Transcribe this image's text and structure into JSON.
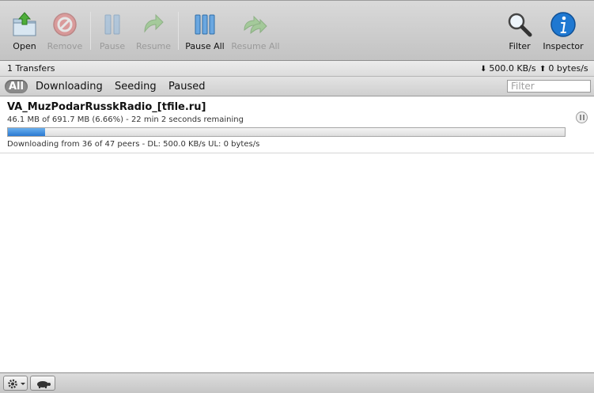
{
  "toolbar": {
    "open": "Open",
    "remove": "Remove",
    "pause": "Pause",
    "resume": "Resume",
    "pause_all": "Pause All",
    "resume_all": "Resume All",
    "filter": "Filter",
    "inspector": "Inspector"
  },
  "status": {
    "transfers": "1 Transfers",
    "download_rate": "500.0 KB/s",
    "upload_rate": "0 bytes/s"
  },
  "filter_tabs": [
    "All",
    "Downloading",
    "Seeding",
    "Paused"
  ],
  "filter_placeholder": "Filter",
  "transfers": [
    {
      "name": "VA_MuzPodarRusskRadio_[tfile.ru]",
      "progress_text": "46.1 MB of 691.7 MB (6.66%) - 22 min 2 seconds remaining",
      "progress_fraction": 0.0666,
      "status_text": "Downloading from 36 of 47 peers - DL: 500.0 KB/s UL: 0 bytes/s"
    }
  ],
  "icons": {
    "open": "open-folder-icon",
    "remove": "remove-icon",
    "pause": "pause-icon",
    "resume": "resume-icon",
    "pause_all": "pause-all-icon",
    "resume_all": "resume-all-icon",
    "filter": "magnifier-icon",
    "inspector": "info-icon",
    "gear": "gear-icon",
    "turtle": "turtle-icon"
  },
  "colors": {
    "progress": "#2a79d1",
    "info_blue": "#1f78d1",
    "disabled_label": "#9a9a9a"
  }
}
